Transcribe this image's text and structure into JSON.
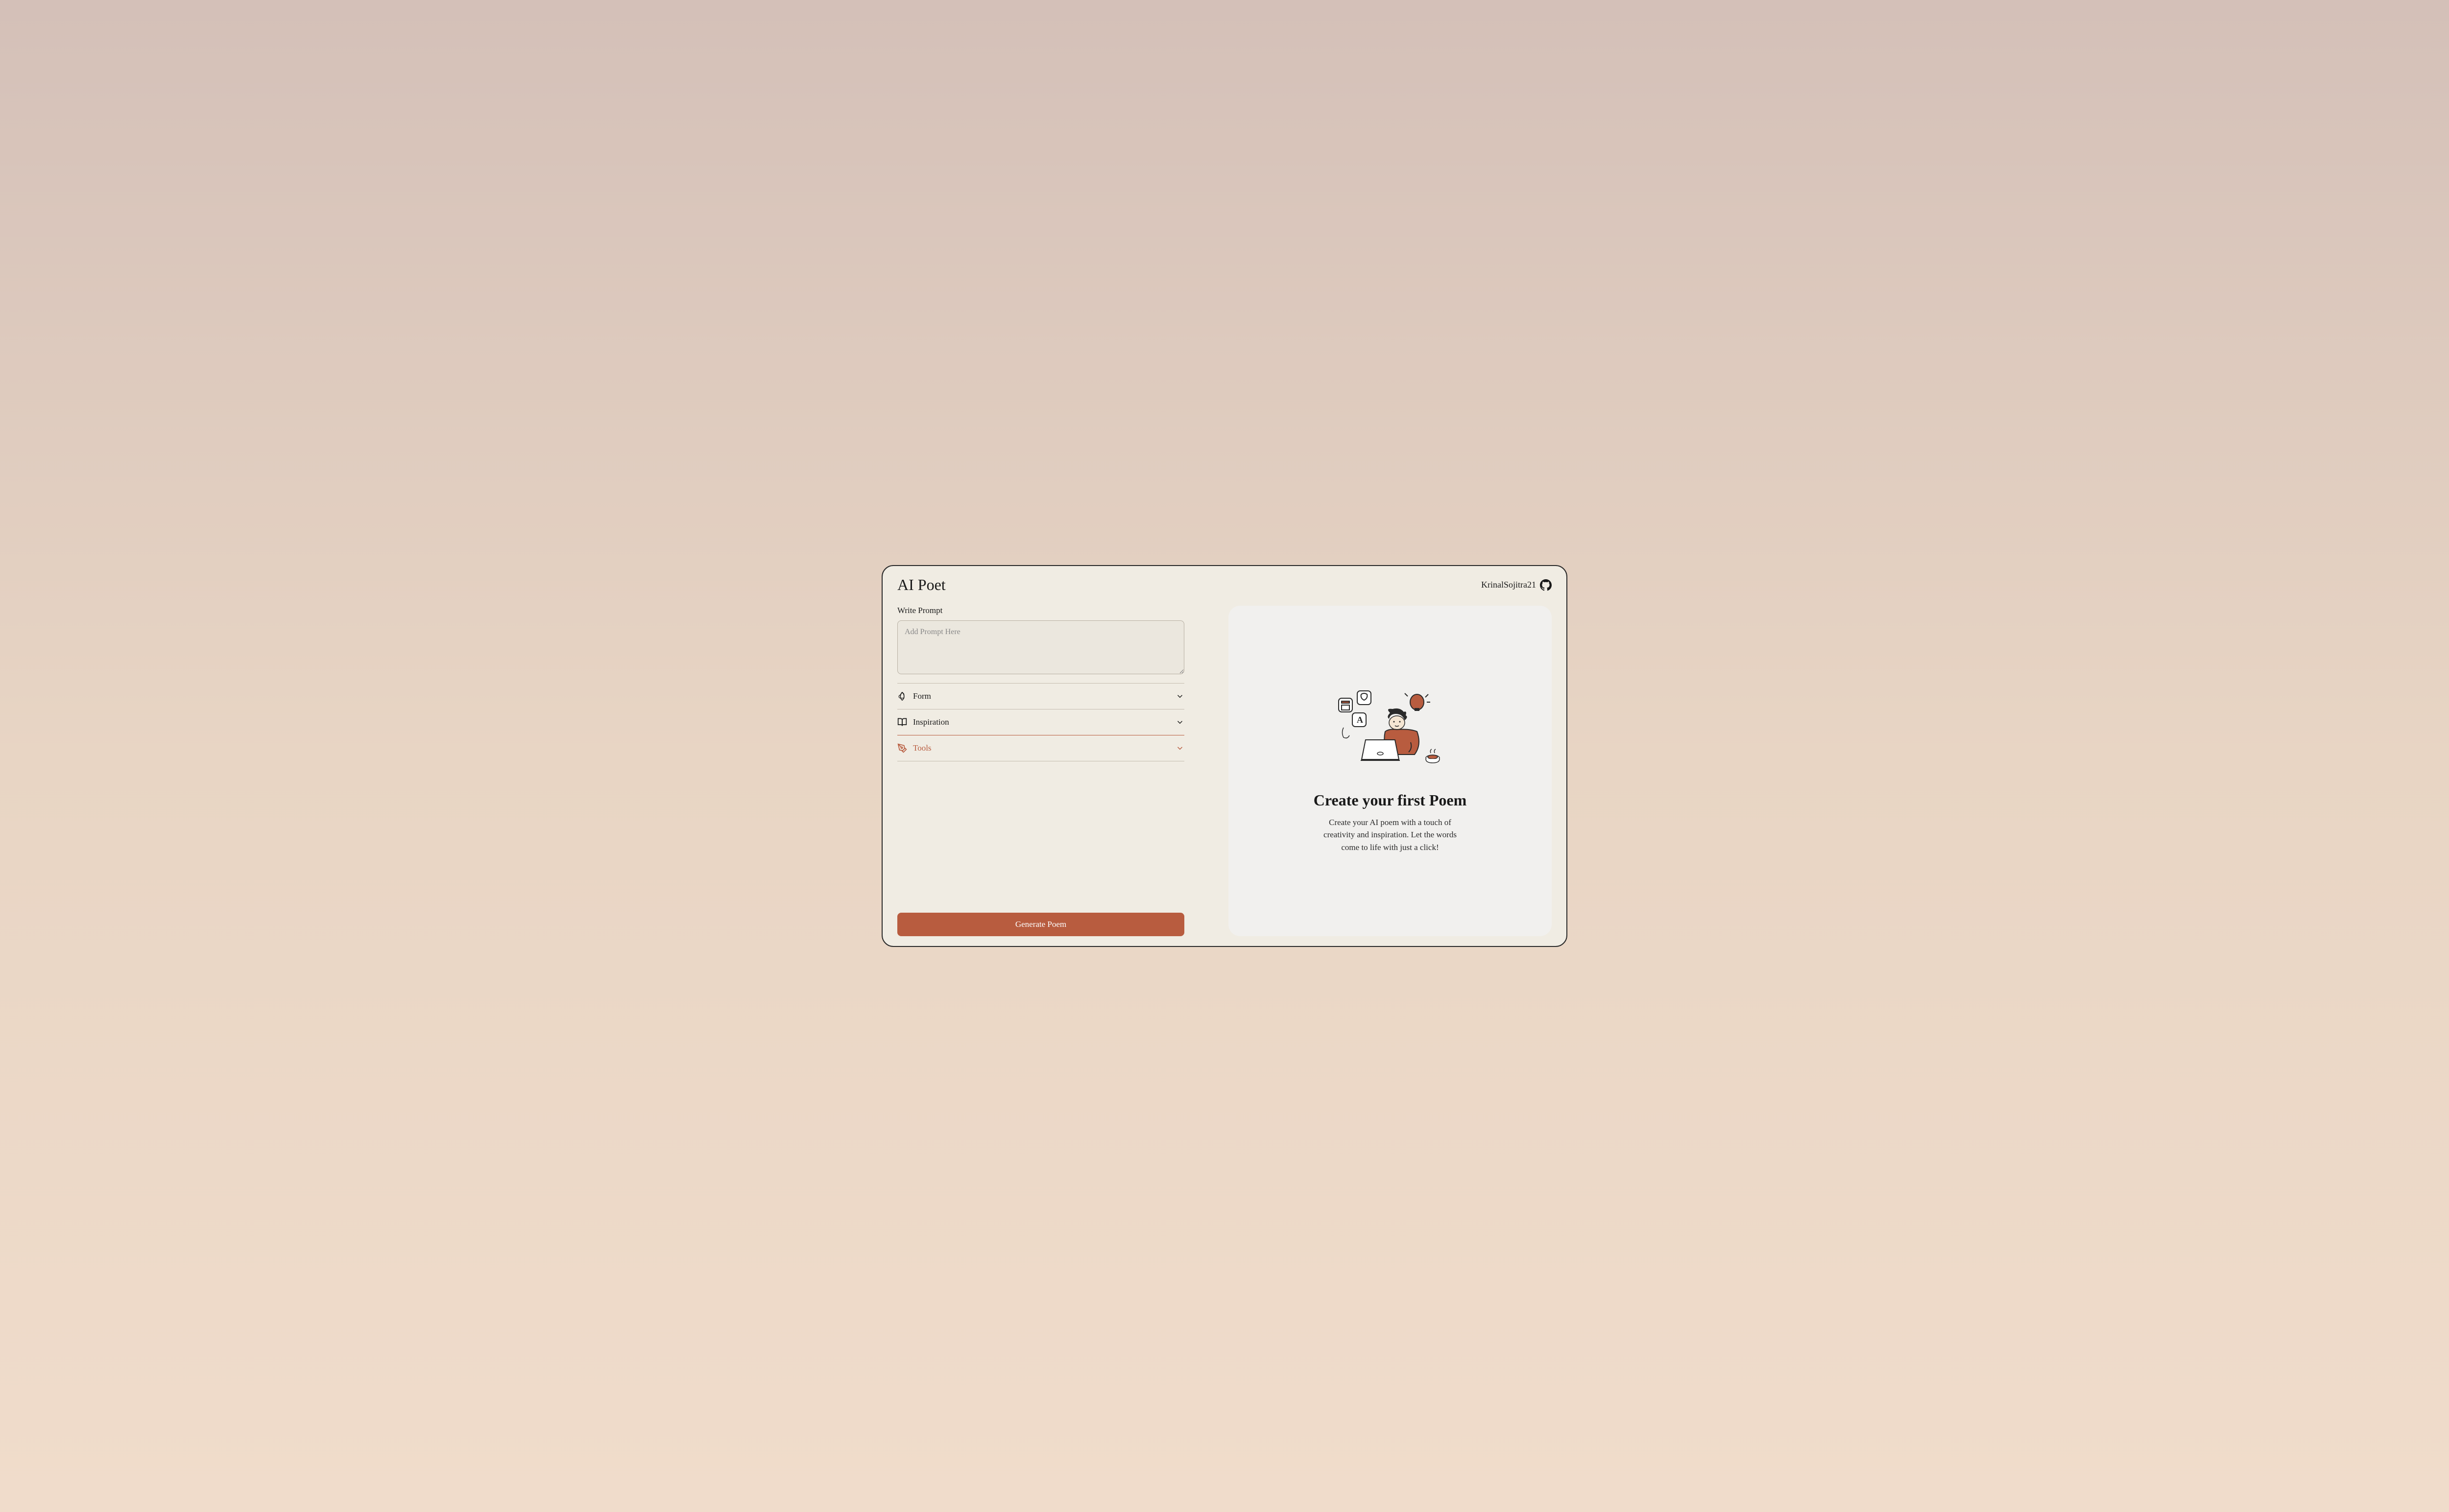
{
  "header": {
    "title": "AI Poet",
    "github_user": "KrinalSojitra21"
  },
  "prompt": {
    "label": "Write Prompt",
    "placeholder": "Add Prompt Here",
    "value": ""
  },
  "accordion": {
    "items": [
      {
        "label": "Form",
        "icon": "leaf",
        "active": false
      },
      {
        "label": "Inspiration",
        "icon": "book",
        "active": false
      },
      {
        "label": "Tools",
        "icon": "pen-tool",
        "active": true
      }
    ]
  },
  "actions": {
    "generate_label": "Generate Poem"
  },
  "welcome": {
    "title": "Create your first Poem",
    "description": "Create your AI poem with a touch of creativity and inspiration. Let the words come to life with just a click!"
  },
  "colors": {
    "accent": "#b85c3f",
    "background": "#f0ece3",
    "panel": "#f1f0ee"
  }
}
